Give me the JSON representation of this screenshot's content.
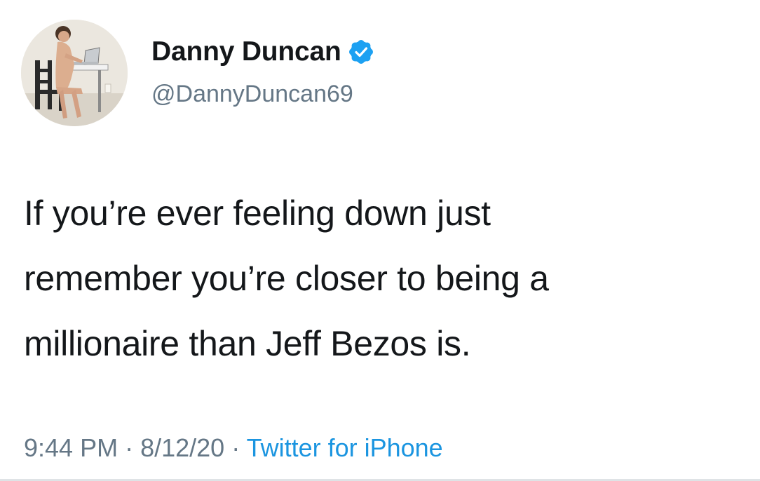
{
  "author": {
    "display_name": "Danny Duncan",
    "handle": "@DannyDuncan69",
    "verified": true,
    "verified_color": "#1da1f2"
  },
  "tweet": {
    "lines": [
      "If you’re ever feeling down just",
      "remember you’re closer to being a",
      "millionaire than Jeff Bezos is."
    ]
  },
  "meta": {
    "time": "9:44 PM",
    "separator": "·",
    "date": "8/12/20",
    "source": "Twitter for iPhone",
    "source_color": "#1b95e0"
  }
}
